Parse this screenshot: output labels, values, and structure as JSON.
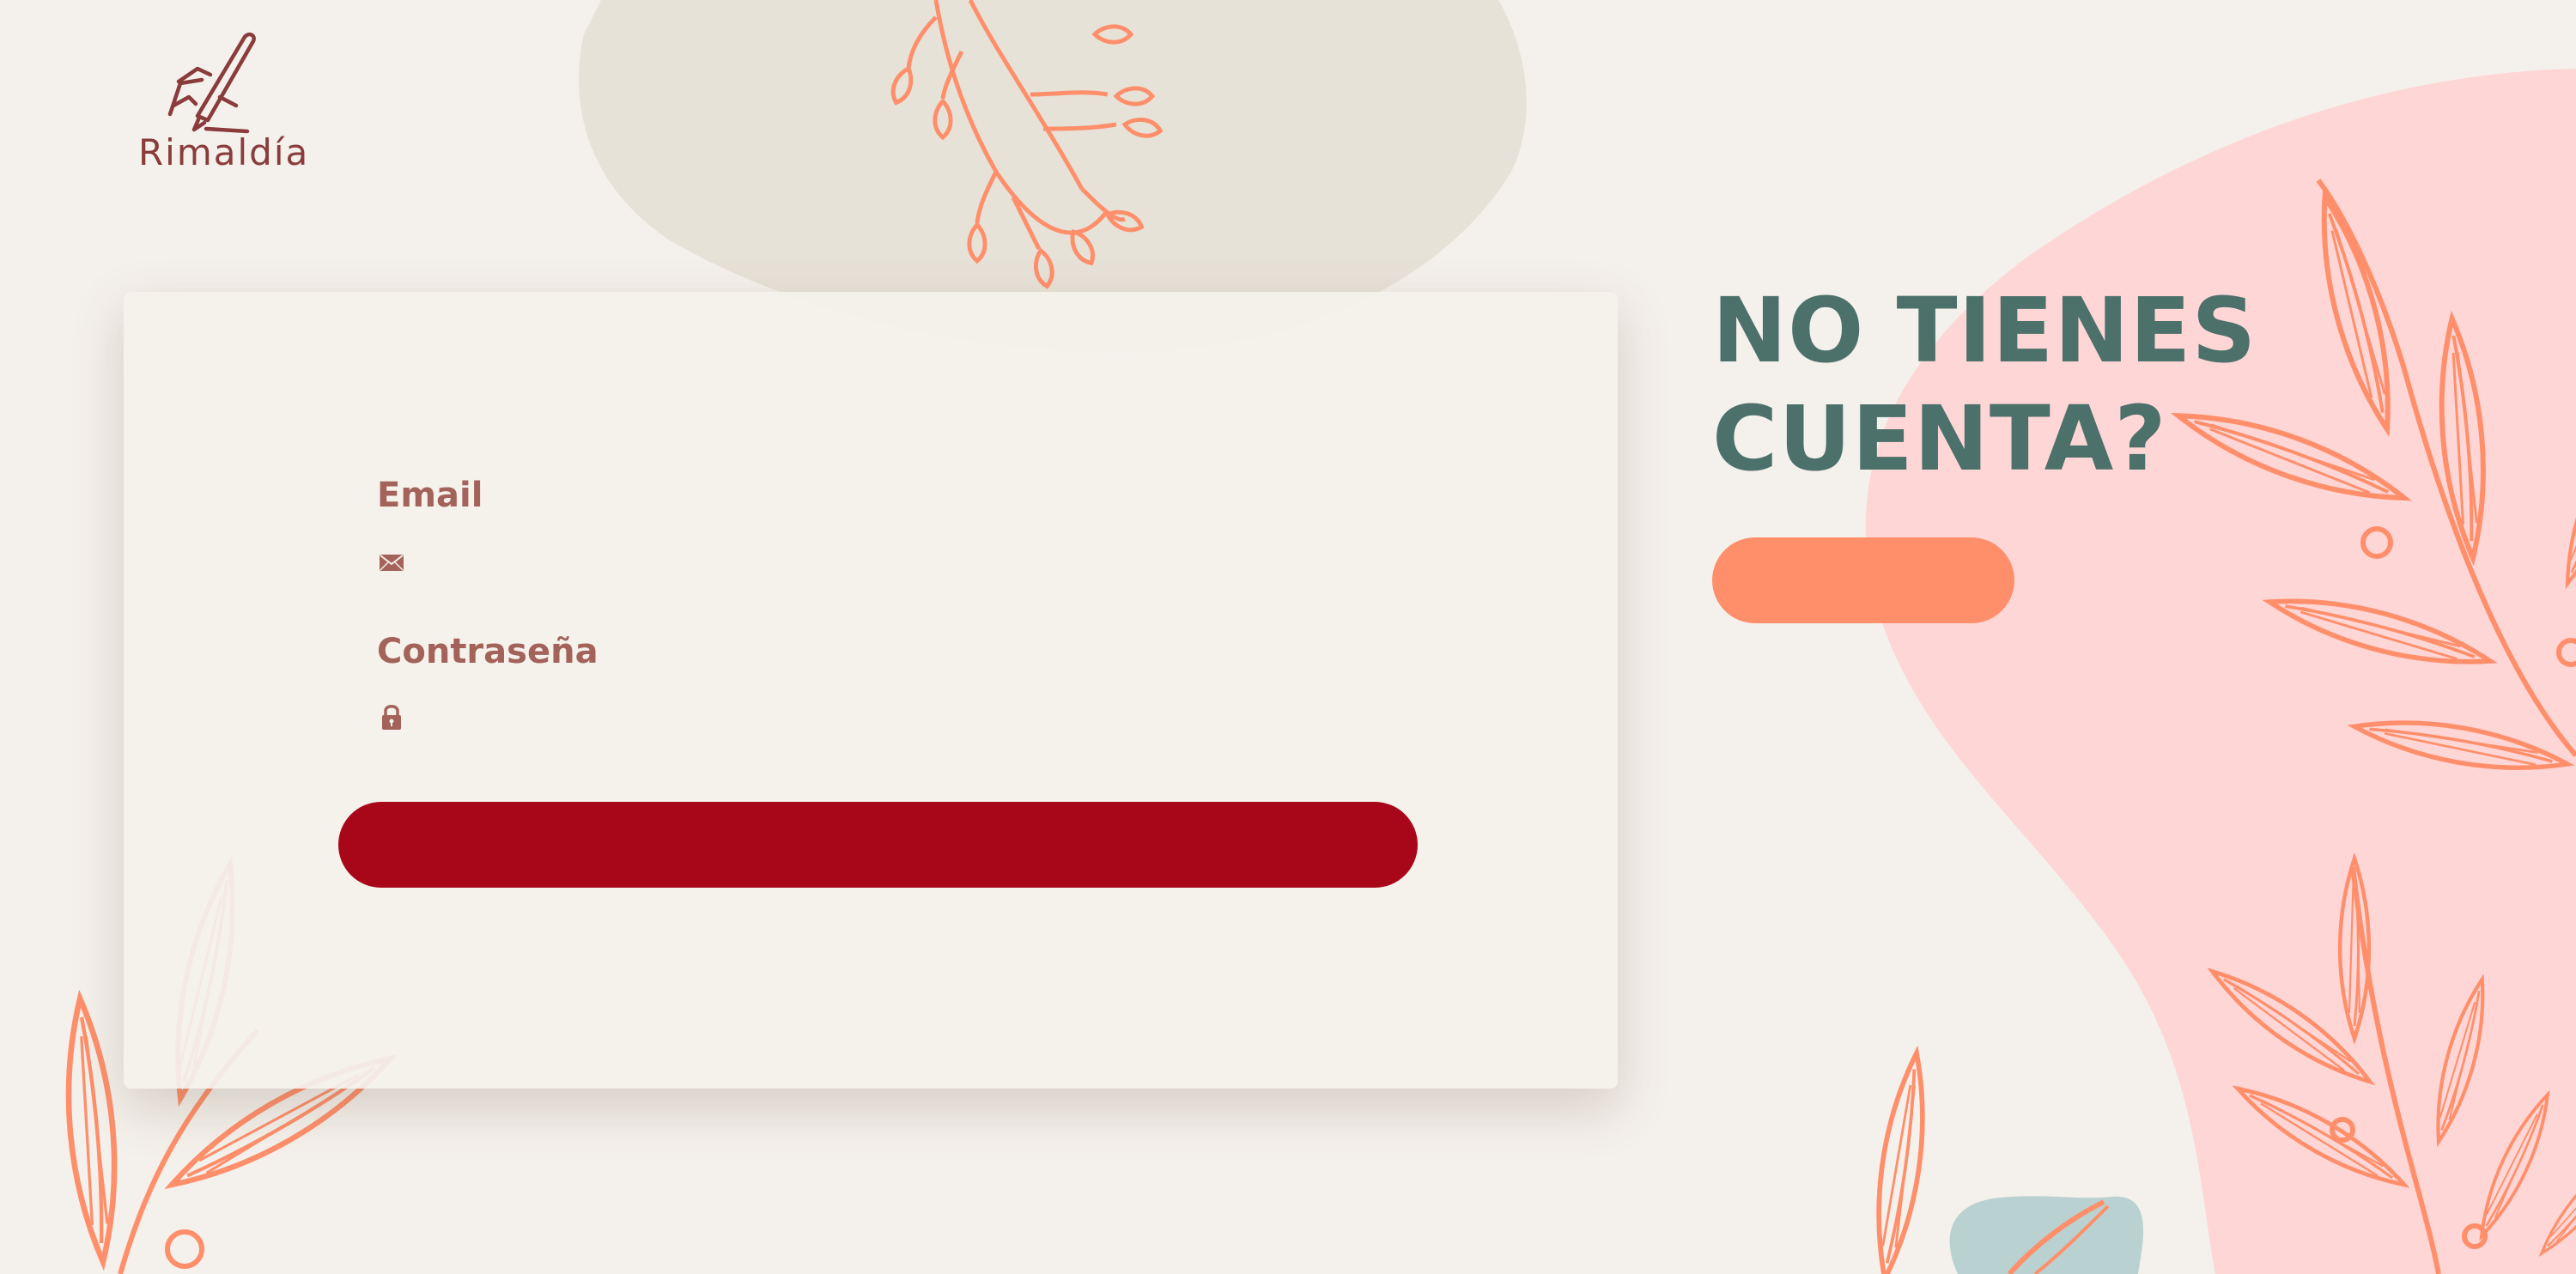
{
  "brand": {
    "name": "Rimaldía"
  },
  "login": {
    "email_label": "Email",
    "email_value": "",
    "email_icon": "envelope-icon",
    "password_label": "Contraseña",
    "password_value": "",
    "password_icon": "lock-icon",
    "submit_label": ""
  },
  "signup": {
    "title_line1": "NO TIENES",
    "title_line2": "CUENTA?",
    "button_label": ""
  },
  "colors": {
    "background": "#f4f0eb",
    "beige_blob": "#e7e2d8",
    "pink_blob": "#ffd6d6",
    "teal_blob": "#b9d2d1",
    "leaf_orange": "#ff8f6b",
    "brand_brown": "#8a3b3b",
    "label_color": "#a3625a",
    "submit_red": "#a8071a",
    "title_teal": "#4c706a",
    "signup_orange": "#ff8f6b"
  }
}
